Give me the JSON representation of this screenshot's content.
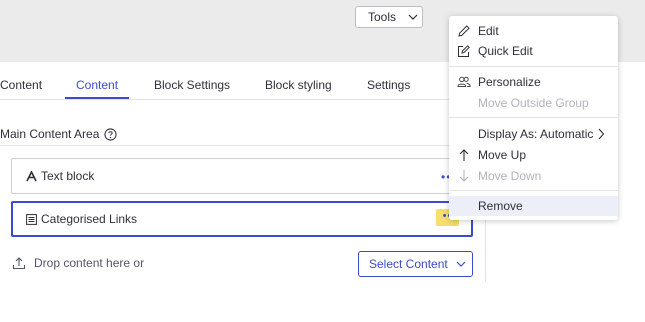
{
  "toolbar": {
    "tools_label": "Tools"
  },
  "tabs": [
    {
      "label": "Content"
    },
    {
      "label": "Content"
    },
    {
      "label": "Block Settings"
    },
    {
      "label": "Block styling"
    },
    {
      "label": "Settings"
    }
  ],
  "area": {
    "label": "Main Content Area"
  },
  "blocks": [
    {
      "label": "Text block"
    },
    {
      "label": "Categorised Links"
    }
  ],
  "drop": {
    "label": "Drop content here or"
  },
  "select_content": {
    "label": "Select Content"
  },
  "context_menu": {
    "items": [
      {
        "label": "Edit"
      },
      {
        "label": "Quick Edit"
      },
      {
        "label": "Personalize"
      },
      {
        "label": "Move Outside Group"
      },
      {
        "label": "Display As: Automatic"
      },
      {
        "label": "Move Up"
      },
      {
        "label": "Move Down"
      },
      {
        "label": "Remove"
      }
    ]
  },
  "colors": {
    "accent": "#3b4bd1",
    "highlight": "#f5dd6e"
  }
}
